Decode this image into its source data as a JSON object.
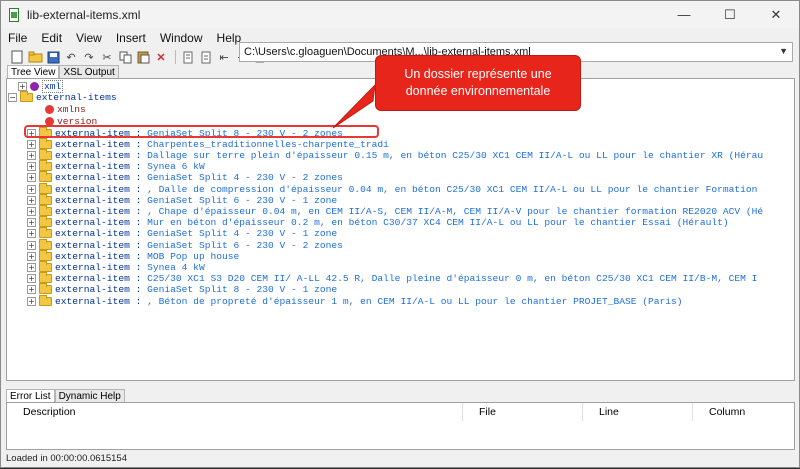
{
  "window": {
    "title": "lib-external-items.xml",
    "minimize": "—",
    "maximize": "☐",
    "close": "✕"
  },
  "menu": [
    "File",
    "Edit",
    "View",
    "Insert",
    "Window",
    "Help"
  ],
  "toolbar": {
    "path": "C:\\Users\\c.gloaguen\\Documents\\M...\\lib-external-items.xml",
    "icons": [
      "new-file-icon",
      "open-folder-icon",
      "save-icon",
      "undo-icon",
      "redo-icon",
      "cut-icon",
      "copy-icon",
      "paste-icon",
      "delete-icon",
      "move-up-icon",
      "move-down-icon",
      "indent-icon",
      "outdent-icon",
      "settings-icon"
    ]
  },
  "tabs": [
    "Tree View",
    "XSL Output"
  ],
  "tree": {
    "root_xml": "xml",
    "root_element": "external-items",
    "attr1": "xmlns",
    "attr2": "version",
    "node_tag": "external-item",
    "separator": " : ",
    "items": [
      "GeniaSet Split 8 - 230 V - 2 zones",
      "Charpentes_traditionnelles-charpente_tradi",
      "Dallage sur terre plein d'épaisseur 0.15 m, en béton C25/30 XC1 CEM II/A-L ou LL pour le chantier XR (Hérau",
      "Synea 6 kW",
      "GeniaSet Split 4 - 230 V - 2 zones",
      ", Dalle de compression d'épaisseur 0.04 m, en béton C25/30 XC1 CEM II/A-L ou LL pour le chantier Formation",
      "GeniaSet Split 6 - 230 V - 1 zone",
      ", Chape d'épaisseur 0.04 m, en CEM II/A-S, CEM II/A-M, CEM II/A-V pour le chantier formation RE2020 ACV (Hé",
      "Mur en béton d'épaisseur 0.2 m, en béton C30/37 XC4 CEM II/A-L ou LL pour le chantier Essai (Hérault)",
      "GeniaSet Split 4 - 230 V - 1 zone",
      "GeniaSet Split 6 - 230 V - 2 zones",
      "MOB Pop up house",
      "Synea 4 kW",
      "C25/30 XC1 S3 D20 CEM II/ A-LL 42.5 R, Dalle pleine d'épaisseur 0 m, en béton C25/30 XC1 CEM II/B-M, CEM I",
      "GeniaSet Split 8 - 230 V - 1 zone",
      ", Béton de propreté d'épaisseur 1 m, en CEM II/A-L ou LL pour le chantier PROJET_BASE (Paris)"
    ]
  },
  "callout": {
    "text": "Un dossier représente une donnée environnementale",
    "color": "#e8251b"
  },
  "bottom_tabs": [
    "Error List",
    "Dynamic Help"
  ],
  "error_columns": [
    "Description",
    "File",
    "Line",
    "Column"
  ],
  "status": "Loaded in 00:00:00.0615154"
}
